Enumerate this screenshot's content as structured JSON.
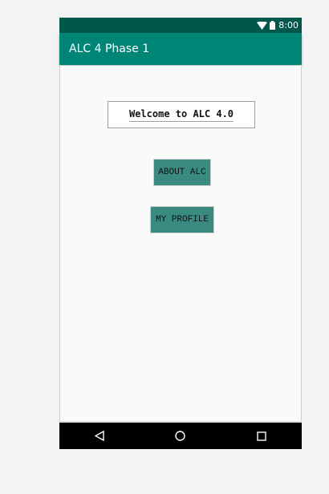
{
  "status_bar": {
    "time": "8:00",
    "icons": [
      "wifi-icon",
      "battery-icon"
    ],
    "background": "#00574b"
  },
  "app_bar": {
    "title": "ALC 4 Phase 1",
    "background": "#008577"
  },
  "main": {
    "welcome_text": "Welcome to ALC 4.0",
    "about_button_label": "ABOUT ALC",
    "profile_button_label": "MY PROFILE",
    "button_color": "#3b8a80"
  },
  "nav_bar": {
    "icons": [
      "back-icon",
      "home-icon",
      "recents-icon"
    ]
  }
}
